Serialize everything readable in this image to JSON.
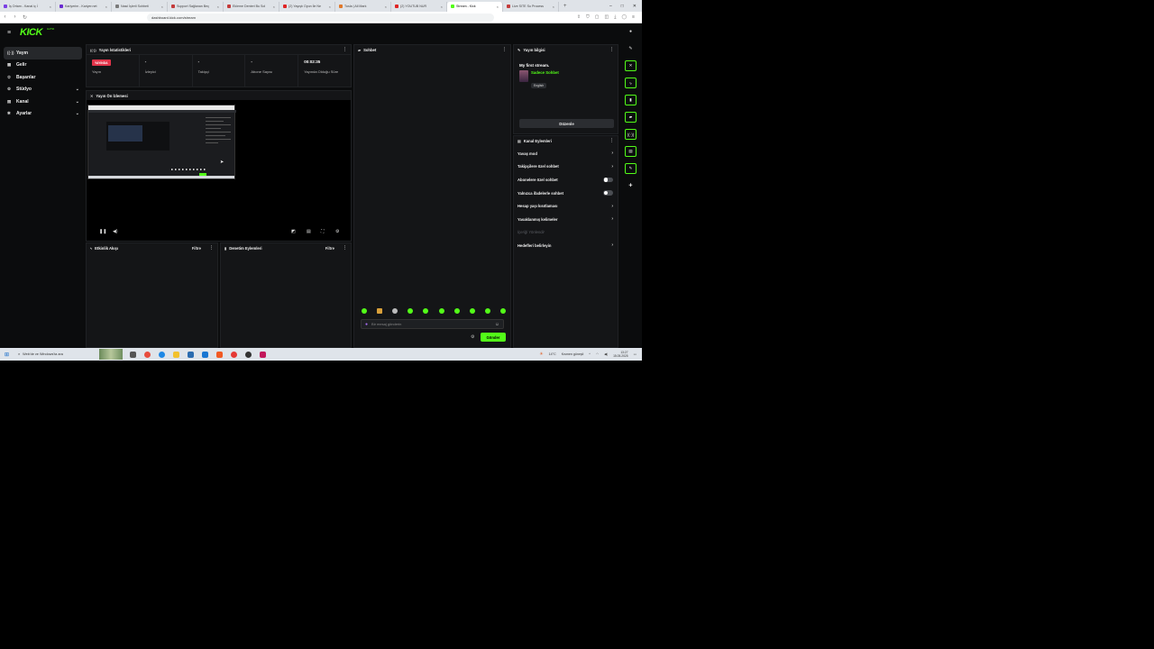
{
  "browser": {
    "tabs": [
      {
        "label": "İş Ortam - Kanal iç İ",
        "color": "#7b3fe4"
      },
      {
        "label": "Kariyerim - Kariyer.net",
        "color": "#6a2bd0"
      },
      {
        "label": "Nasıl İşlerli Sohbeti",
        "color": "#7a7a7a"
      },
      {
        "label": "Support Sağlanan Beç",
        "color": "#c43b3b"
      },
      {
        "label": "Ekleme Denteri Bu Sol",
        "color": "#c43b3b"
      },
      {
        "label": "(2) Yayıştı Oyun İle Ne",
        "color": "#e02424"
      },
      {
        "label": "Tusla | All Mark",
        "color": "#e0782a"
      },
      {
        "label": "(2) YOUTUB NUR",
        "color": "#e02424"
      },
      {
        "label": "Stream - Kick",
        "color": "#53fc18",
        "active": true
      },
      {
        "label": "Live SITE Su Process",
        "color": "#c43b3b"
      }
    ],
    "new_tab": "+",
    "url": "dashboard.kick.com/stream",
    "window_controls": [
      "–",
      "□",
      "✕"
    ]
  },
  "sidebar": {
    "logo": "KICK",
    "logo_sup": "ALPHA",
    "items": [
      {
        "label": "Yayın",
        "icon": "((·))",
        "active": true,
        "chevron": false
      },
      {
        "label": "Gelir",
        "icon": "▦",
        "chevron": false
      },
      {
        "label": "Başarılar",
        "icon": "♔",
        "chevron": false
      },
      {
        "label": "Stüdyo",
        "icon": "⚙",
        "chevron": true
      },
      {
        "label": "Kanal",
        "icon": "▤",
        "chevron": true
      },
      {
        "label": "Ayarlar",
        "icon": "✱",
        "chevron": true
      }
    ]
  },
  "stats": {
    "title": "Yayın İstatistikleri",
    "live_badge": "YAYINDA",
    "items": [
      {
        "value": "",
        "label": "Yayın",
        "badge": true
      },
      {
        "value": "-",
        "label": "İzleyici"
      },
      {
        "value": "-",
        "label": "Takipçi"
      },
      {
        "value": "-",
        "label": "Abone Sayısı"
      },
      {
        "value": "00:02:35",
        "label": "Yayında Olduğu Süre"
      }
    ]
  },
  "preview": {
    "title": "Yayın Ön İzlemesi"
  },
  "activity": {
    "title": "Etkinlik Akışı",
    "filter": "Filtre"
  },
  "moderation": {
    "title": "Denetim Eylemleri",
    "filter": "Filtre"
  },
  "chat": {
    "title": "Sohbet",
    "placeholder": "Bir mesaj gönderin",
    "send_label": "Gönder"
  },
  "info": {
    "title": "Yayın bilgisi",
    "stream_title": "My first stream.",
    "category": "Sadece Sohbet",
    "language": "English",
    "edit_label": "Düzenle"
  },
  "actions": {
    "title": "Kanal Eylemleri",
    "items": [
      {
        "label": "Yavaş mod",
        "type": "chevron"
      },
      {
        "label": "Takipçilere özel sohbet",
        "type": "chevron"
      },
      {
        "label": "Abonelere özel sohbet",
        "type": "toggle"
      },
      {
        "label": "Yalnızca ifadelerle sohbet",
        "type": "toggle"
      },
      {
        "label": "Hesap yaşı kısıtlaması",
        "type": "chevron"
      },
      {
        "label": "Yasaklanmış kelimeler",
        "type": "chevron"
      },
      {
        "label": "İçeriği Yönlendir",
        "type": "disabled"
      },
      {
        "label": "Hedefleri belirleyin",
        "type": "chevron"
      }
    ]
  },
  "taskbar": {
    "search_placeholder": "Web'de ve Windows'ta ara",
    "weather_temp": "14°C",
    "weather_desc": "Kısmen güneşli",
    "time": "13:27",
    "date": "15.05.2025"
  },
  "colors": {
    "accent": "#53fc18",
    "live": "#e2344a"
  }
}
